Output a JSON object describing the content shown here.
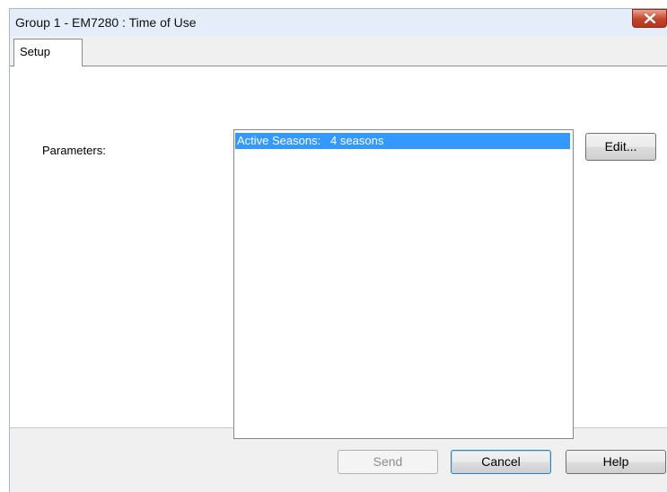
{
  "window": {
    "title": "Group 1 - EM7280 : Time of Use",
    "close_icon": "close-icon"
  },
  "tabs": [
    {
      "label": "Setup",
      "selected": true
    }
  ],
  "setup": {
    "parameters_label": "Parameters:",
    "list_items": [
      {
        "text": "Active Seasons:   4 seasons",
        "selected": true
      }
    ],
    "edit_label": "Edit..."
  },
  "footer": {
    "send_label": "Send",
    "send_enabled": false,
    "cancel_label": "Cancel",
    "help_label": "Help"
  },
  "colors": {
    "selection": "#3399ff",
    "titlebar": "#e5eef8",
    "close_button": "#c4432b"
  }
}
